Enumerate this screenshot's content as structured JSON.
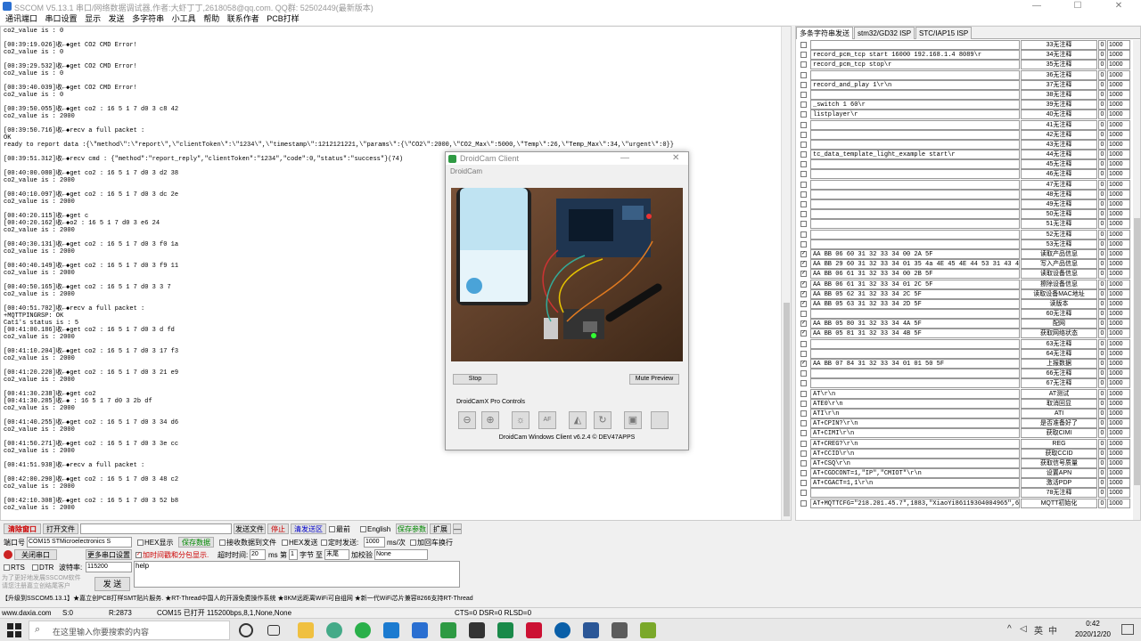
{
  "window": {
    "title": "SSCOM V5.13.1 串口/网络数据调试器,作者:大虾丁丁,2618058@qq.com. QQ群: 52502449(最新版本)",
    "controls": [
      "—",
      "☐",
      "✕"
    ]
  },
  "menu": [
    "通讯端口",
    "串口设置",
    "显示",
    "发送",
    "多字符串",
    "小工具",
    "帮助",
    "联系作者",
    "PCB打样"
  ],
  "log_lines": [
    "co2_value is : 0",
    "",
    "[00:39:19.026]收←◆get CO2 CMD Error!",
    "co2_value is : 0",
    "",
    "[00:39:29.532]收←◆get CO2 CMD Error!",
    "co2_value is : 0",
    "",
    "[00:39:40.039]收←◆get CO2 CMD Error!",
    "co2_value is : 0",
    "",
    "[00:39:50.055]收←◆get co2 : 16 5 1 7 d0 3 c8 42",
    "co2_value is : 2000",
    "",
    "[00:39:50.716]收←◆recv a full packet :",
    "OK",
    "ready to report data :{\\\"method\\\":\\\"report\\\",\\\"clientToken\\\":\\\"1234\\\",\\\"timestamp\\\":1212121221,\\\"params\\\":{\\\"CO2\\\":2000,\\\"CO2_Max\\\":5000,\\\"Temp\\\":26,\\\"Temp_Max\\\":34,\\\"urgent\\\":0}}",
    "",
    "[00:39:51.312]收←◆recv cmd : {\"method\":\"report_reply\",\"clientToken\":\"1234\",\"code\":0,\"status\":\"success\"}(74)",
    "",
    "[00:40:00.080]收←◆get co2 : 16 5 1 7 d0 3 d2 38",
    "co2_value is : 2000",
    "",
    "[00:40:10.097]收←◆get co2 : 16 5 1 7 d0 3 dc 2e",
    "co2_value is : 2000",
    "",
    "[00:40:20.115]收←◆get c",
    "[00:40:20.162]收←◆o2 : 16 5 1 7 d0 3 e6 24",
    "co2_value is : 2000",
    "",
    "[00:40:30.131]收←◆get co2 : 16 5 1 7 d0 3 f0 1a",
    "co2_value is : 2000",
    "",
    "[00:40:40.149]收←◆get co2 : 16 5 1 7 d0 3 f9 11",
    "co2_value is : 2000",
    "",
    "[00:40:50.165]收←◆get co2 : 16 5 1 7 d0 3 3 7",
    "co2_value is : 2000",
    "",
    "[00:40:51.702]收←◆recv a full packet :",
    "+MQTTPINGRSP: OK",
    "Cat1's status is : 5",
    "[00:41:00.186]收←◆get co2 : 16 5 1 7 d0 3 d fd",
    "co2_value is : 2000",
    "",
    "[00:41:10.204]收←◆get co2 : 16 5 1 7 d0 3 17 f3",
    "co2_value is : 2000",
    "",
    "[00:41:20.220]收←◆get co2 : 16 5 1 7 d0 3 21 e9",
    "co2_value is : 2000",
    "",
    "[00:41:30.238]收←◆get co2",
    "[00:41:30.285]收←◆ : 16 5 1 7 d0 3 2b df",
    "co2_value is : 2000",
    "",
    "[00:41:40.255]收←◆get co2 : 16 5 1 7 d0 3 34 d6",
    "co2_value is : 2000",
    "",
    "[00:41:50.271]收←◆get co2 : 16 5 1 7 d0 3 3e cc",
    "co2_value is : 2000",
    "",
    "[00:41:51.938]收←◆recv a full packet :",
    "",
    "[00:42:00.290]收←◆get co2 : 16 5 1 7 d0 3 48 c2",
    "co2_value is : 2000",
    "",
    "[00:42:10.308]收←◆get co2 : 16 5 1 7 d0 3 52 b8",
    "co2_value is : 2000"
  ],
  "right_panel": {
    "tabs": [
      "多条字符串发送",
      "stm32/GD32 ISP",
      "STC/IAP15 ISP"
    ],
    "rows": [
      {
        "c": false,
        "cmd": "",
        "lbl": "33无注释",
        "z": "0",
        "ms": "1000"
      },
      {
        "c": false,
        "cmd": "record_pcm_tcp start 16000 192.168.1.4 8089\\r",
        "lbl": "34无注释",
        "z": "0",
        "ms": "1000"
      },
      {
        "c": false,
        "cmd": "record_pcm_tcp stop\\r",
        "lbl": "35无注释",
        "z": "0",
        "ms": "1000"
      },
      {
        "c": false,
        "cmd": "",
        "lbl": "36无注释",
        "z": "0",
        "ms": "1000"
      },
      {
        "c": false,
        "cmd": "record_and_play 1\\r\\n",
        "lbl": "37无注释",
        "z": "0",
        "ms": "1000"
      },
      {
        "c": false,
        "cmd": "",
        "lbl": "38无注释",
        "z": "0",
        "ms": "1000"
      },
      {
        "c": false,
        "cmd": "_switch 1 60\\r",
        "lbl": "39无注释",
        "z": "0",
        "ms": "1000"
      },
      {
        "c": false,
        "cmd": "listplayer\\r",
        "lbl": "40无注释",
        "z": "0",
        "ms": "1000"
      },
      {
        "c": false,
        "cmd": "",
        "lbl": "41无注释",
        "z": "0",
        "ms": "1000"
      },
      {
        "c": false,
        "cmd": "",
        "lbl": "42无注释",
        "z": "0",
        "ms": "1000"
      },
      {
        "c": false,
        "cmd": "",
        "lbl": "43无注释",
        "z": "0",
        "ms": "1000"
      },
      {
        "c": false,
        "cmd": "tc_data_template_light_example start\\r",
        "lbl": "44无注释",
        "z": "0",
        "ms": "1000"
      },
      {
        "c": false,
        "cmd": "",
        "lbl": "45无注释",
        "z": "0",
        "ms": "1000"
      },
      {
        "c": false,
        "cmd": "",
        "lbl": "46无注释",
        "z": "0",
        "ms": "1000"
      },
      {
        "c": false,
        "cmd": "",
        "lbl": "47无注释",
        "z": "0",
        "ms": "1000"
      },
      {
        "c": false,
        "cmd": "",
        "lbl": "48无注释",
        "z": "0",
        "ms": "1000"
      },
      {
        "c": false,
        "cmd": "",
        "lbl": "49无注释",
        "z": "0",
        "ms": "1000"
      },
      {
        "c": false,
        "cmd": "",
        "lbl": "50无注释",
        "z": "0",
        "ms": "1000"
      },
      {
        "c": false,
        "cmd": "",
        "lbl": "51无注释",
        "z": "0",
        "ms": "1000"
      },
      {
        "c": false,
        "cmd": "",
        "lbl": "52无注释",
        "z": "0",
        "ms": "1000"
      },
      {
        "c": false,
        "cmd": "",
        "lbl": "53无注释",
        "z": "0",
        "ms": "1000"
      },
      {
        "c": true,
        "cmd": "AA BB 06 60 31 32 33 34 00 2A 5F",
        "lbl": "读取产品信息",
        "z": "0",
        "ms": "1000"
      },
      {
        "c": true,
        "cmd": "AA BB 29 60 31 32 33 34 01 35 4a 4E 45 4E 44 53 31 43 47 2",
        "lbl": "写入产品信息",
        "z": "0",
        "ms": "1000"
      },
      {
        "c": true,
        "cmd": "AA BB 06 61 31 32 33 34 00 2B 5F",
        "lbl": "读取设备信息",
        "z": "0",
        "ms": "1000"
      },
      {
        "c": true,
        "cmd": "AA BB 06 61 31 32 33 34 01 2C 5F",
        "lbl": "擦除设备信息",
        "z": "0",
        "ms": "1000"
      },
      {
        "c": true,
        "cmd": "AA BB 05 62 31 32 33 34 2C 5F",
        "lbl": "读取设备MAC地址",
        "z": "0",
        "ms": "1000"
      },
      {
        "c": true,
        "cmd": "AA BB 05 63 31 32 33 34 2D 5F",
        "lbl": "读版本",
        "z": "0",
        "ms": "1000"
      },
      {
        "c": false,
        "cmd": "",
        "lbl": "60无注释",
        "z": "0",
        "ms": "1000"
      },
      {
        "c": true,
        "cmd": "AA BB 05 80 31 32 33 34 4A 5F",
        "lbl": "配网",
        "z": "0",
        "ms": "1000"
      },
      {
        "c": true,
        "cmd": "AA BB 05 81 31 32 33 34 4B 5F",
        "lbl": "获取网络状态",
        "z": "0",
        "ms": "1000"
      },
      {
        "c": false,
        "cmd": "",
        "lbl": "63无注释",
        "z": "0",
        "ms": "1000"
      },
      {
        "c": false,
        "cmd": "",
        "lbl": "64无注释",
        "z": "0",
        "ms": "1000"
      },
      {
        "c": true,
        "cmd": "AA BB 07 84 31 32 33 34 01 01 50 5F",
        "lbl": "上报数据",
        "z": "0",
        "ms": "1000"
      },
      {
        "c": false,
        "cmd": "",
        "lbl": "66无注释",
        "z": "0",
        "ms": "1000"
      },
      {
        "c": false,
        "cmd": "",
        "lbl": "67无注释",
        "z": "0",
        "ms": "1000"
      },
      {
        "c": false,
        "cmd": "AT\\r\\n",
        "lbl": "AT测试",
        "z": "0",
        "ms": "1000"
      },
      {
        "c": false,
        "cmd": "ATE0\\r\\n",
        "lbl": "取消回显",
        "z": "0",
        "ms": "1000"
      },
      {
        "c": false,
        "cmd": "ATI\\r\\n",
        "lbl": "ATI",
        "z": "0",
        "ms": "1000"
      },
      {
        "c": false,
        "cmd": "AT+CPIN?\\r\\n",
        "lbl": "是否准备好了",
        "z": "0",
        "ms": "1000"
      },
      {
        "c": false,
        "cmd": "AT+CIMI\\r\\n",
        "lbl": "获取CIMI",
        "z": "0",
        "ms": "1000"
      },
      {
        "c": false,
        "cmd": "AT+CREG?\\r\\n",
        "lbl": "REG",
        "z": "0",
        "ms": "1000"
      },
      {
        "c": false,
        "cmd": "AT+CCID\\r\\n",
        "lbl": "获取CCID",
        "z": "0",
        "ms": "1000"
      },
      {
        "c": false,
        "cmd": "AT+CSQ\\r\\n",
        "lbl": "获取信号质量",
        "z": "0",
        "ms": "1000"
      },
      {
        "c": false,
        "cmd": "AT+CGDCONT=1,\"IP\",\"CMIOT\"\\r\\n",
        "lbl": "设置APN",
        "z": "0",
        "ms": "1000"
      },
      {
        "c": false,
        "cmd": "AT+CGACT=1,1\\r\\n",
        "lbl": "激活PDP",
        "z": "0",
        "ms": "1000"
      },
      {
        "c": false,
        "cmd": "",
        "lbl": "78无注释",
        "z": "0",
        "ms": "1000"
      },
      {
        "c": false,
        "cmd": "AT+MQTTCFG=\"218.201.45.7\",1883,\"XiaoYi86119304004965\",60,",
        "lbl": "MQTT初始化",
        "z": "0",
        "ms": "1000"
      }
    ]
  },
  "droidcam": {
    "title": "DroidCam Client",
    "app": "DroidCam",
    "stop": "Stop",
    "mute": "Mute Preview",
    "pro": "DroidCamX Pro Controls",
    "footer": "DroidCam Windows Client v6.2.4 © DEV47APPS"
  },
  "bottom": {
    "clear": "清除窗口",
    "openfile": "打开文件",
    "sendfile": "发送文件",
    "stop": "停止",
    "clearsend": "清发送区",
    "top": "最前",
    "english": "English",
    "saveparam": "保存参数",
    "expand": "扩展",
    "dash": "—",
    "port_label": "端口号",
    "port_value": "COM15 STMicroelectronics S",
    "hex_display": "HEX显示",
    "save_data": "保存数据",
    "recv_file": "接收数据到文件",
    "hex_send": "HEX发送",
    "timed_send": "定时发送:",
    "interval": "1000",
    "interval_unit": "ms/次",
    "add_crlf": "加回车换行",
    "close_port": "关闭串口",
    "more_settings": "更多串口设置",
    "add_ts": "加时间戳和分包显示.",
    "timeout_label": "超时时间:",
    "timeout": "20",
    "ms": "ms",
    "no": "第",
    "byte1": "1",
    "byte_label": "字节",
    "to": "至",
    "end": "末尾",
    "checksum_label": "加校验",
    "checksum": "None",
    "rts": "RTS",
    "dtr": "DTR",
    "baud_label": "波特率:",
    "baud": "115200",
    "input": "help",
    "promo1": "为了更好地发展SSCOM软件",
    "promo2": "请您注册嘉立创结尾客户",
    "send": "发 送",
    "ticker": "【升级到SSCOM5.13.1】★嘉立创PCB打样SMT贴片服务. ★RT-Thread中国人的开源免费操作系统 ★8KM远距离WiFi可自组网 ★新一代WiFi芯片兼容8266支持RT-Thread"
  },
  "status": {
    "site": "www.daxia.com",
    "s": "S:0",
    "r": "R:2873",
    "port": "COM15 已打开  115200bps,8,1,None,None",
    "lines": "CTS=0 DSR=0 RLSD=0"
  },
  "taskbar": {
    "search": "在这里输入你要搜索的内容",
    "time": "0:42",
    "date": "2020/12/20",
    "ime": "英",
    "temp": "中"
  }
}
